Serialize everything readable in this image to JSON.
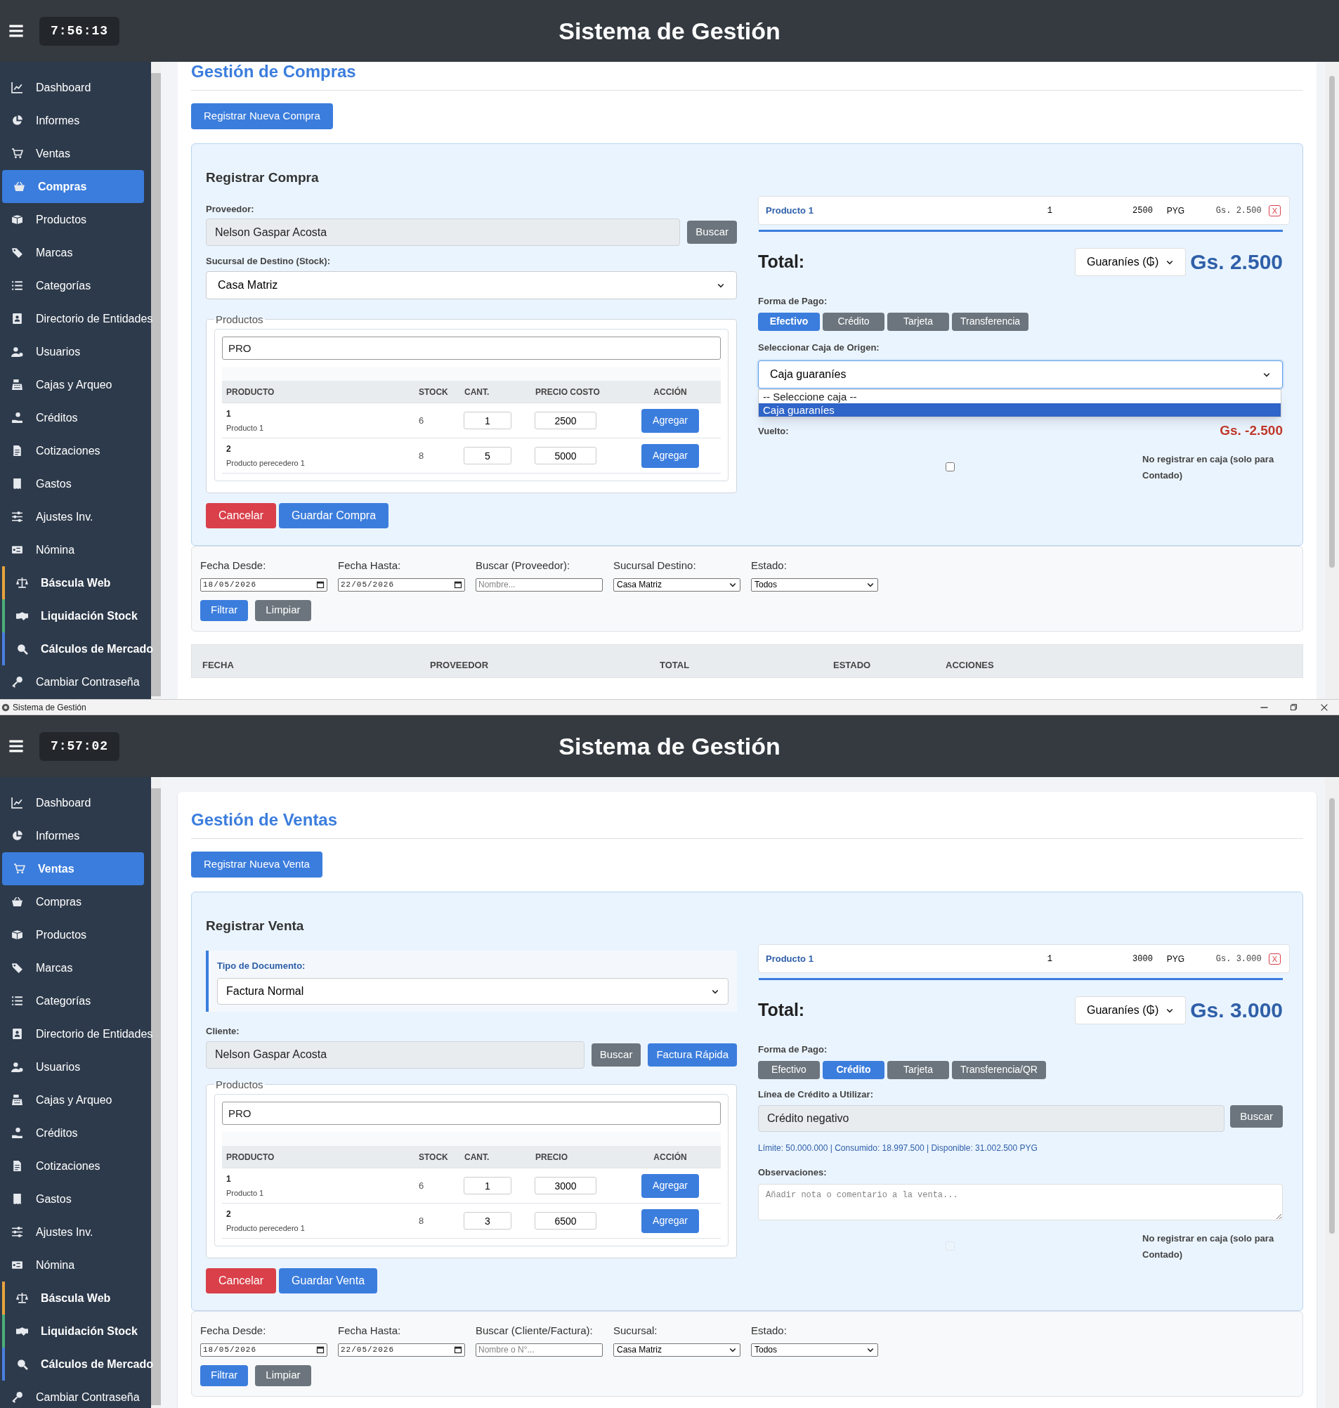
{
  "screens": [
    {
      "header": {
        "clock": "7:56:13",
        "title": "Sistema de Gestión"
      },
      "sidebar": [
        {
          "label": "Dashboard",
          "selected": false
        },
        {
          "label": "Informes",
          "selected": false
        },
        {
          "label": "Ventas",
          "selected": false
        },
        {
          "label": "Compras",
          "selected": true
        },
        {
          "label": "Productos",
          "selected": false
        },
        {
          "label": "Marcas",
          "selected": false
        },
        {
          "label": "Categorías",
          "selected": false
        },
        {
          "label": "Directorio de Entidades",
          "selected": false
        },
        {
          "label": "Usuarios",
          "selected": false
        },
        {
          "label": "Cajas y Arqueo",
          "selected": false
        },
        {
          "label": "Créditos",
          "selected": false
        },
        {
          "label": "Cotizaciones",
          "selected": false
        },
        {
          "label": "Gastos",
          "selected": false
        },
        {
          "label": "Ajustes Inv.",
          "selected": false
        },
        {
          "label": "Nómina",
          "selected": false
        },
        {
          "label": "Báscula Web",
          "selected": false,
          "color": "#e8a33d"
        },
        {
          "label": "Liquidación Stock",
          "selected": false,
          "color": "#4caf7a"
        },
        {
          "label": "Cálculos de Mercado",
          "selected": false,
          "color": "#4a7fe0"
        },
        {
          "label": "Cambiar Contraseña",
          "selected": false
        }
      ],
      "page_title": "Gestión de Compras",
      "new_button": "Registrar Nueva Compra",
      "form": {
        "title": "Registrar Compra",
        "fields": [
          {
            "kind": "lookup",
            "label": "Proveedor:",
            "value": "Nelson Gaspar Acosta",
            "buttons": [
              {
                "label": "Buscar",
                "kind": "secondary"
              }
            ]
          },
          {
            "kind": "select",
            "label": "Sucursal de Destino (Stock):",
            "value": "Casa Matriz"
          }
        ],
        "products": {
          "legend": "Productos",
          "search": "PRO",
          "columns": [
            "PRODUCTO",
            "STOCK",
            "CANT.",
            "PRECIO COSTO",
            "ACCIÓN"
          ],
          "rows": [
            {
              "code": "1",
              "name": "Producto 1",
              "stock": "6",
              "qty": "1",
              "price": "2500",
              "action": "Agregar"
            },
            {
              "code": "2",
              "name": "Producto perecedero 1",
              "stock": "8",
              "qty": "5",
              "price": "5000",
              "action": "Agregar"
            }
          ]
        },
        "buttons": [
          {
            "label": "Cancelar",
            "kind": "danger"
          },
          {
            "label": "Guardar Compra",
            "kind": "primary"
          }
        ]
      },
      "cart": {
        "items": [
          {
            "name": "Producto 1",
            "qty": "1",
            "price": "2500",
            "currency": "PYG",
            "subtotal": "Gs. 2.500",
            "remove": "X"
          }
        ],
        "total_label": "Total:",
        "currency_select": "Guaraníes (₲)",
        "total": "Gs. 2.500",
        "payment_label": "Forma de Pago:",
        "payment_methods": [
          {
            "label": "Efectivo",
            "selected": true
          },
          {
            "label": "Crédito",
            "selected": false
          },
          {
            "label": "Tarjeta",
            "selected": false
          },
          {
            "label": "Transferencia",
            "selected": false
          }
        ],
        "sections": [
          {
            "kind": "select",
            "label": "Seleccionar Caja de Origen:",
            "value": "Caja guaraníes",
            "expanded": true,
            "options": [
              {
                "label": "-- Seleccione caja --",
                "selected": false
              },
              {
                "label": "Caja guaraníes",
                "selected": true
              }
            ]
          },
          {
            "kind": "change",
            "label": "Vuelto:",
            "value": "Gs. -2.500"
          }
        ],
        "no_register": {
          "checked": false,
          "disabled": false,
          "label": "No registrar en caja (solo para Contado)"
        }
      },
      "filters": {
        "fields": [
          {
            "kind": "date",
            "label": "Fecha Desde:",
            "value": "18/05/2026"
          },
          {
            "kind": "date",
            "label": "Fecha Hasta:",
            "value": "22/05/2026"
          },
          {
            "kind": "text",
            "label": "Buscar (Proveedor):",
            "placeholder": "Nombre..."
          },
          {
            "kind": "select",
            "label": "Sucursal Destino:",
            "value": "Casa Matriz"
          },
          {
            "kind": "select",
            "label": "Estado:",
            "value": "Todos"
          }
        ],
        "buttons": [
          {
            "label": "Filtrar",
            "kind": "primary"
          },
          {
            "label": "Limpiar",
            "kind": "secondary"
          }
        ]
      },
      "table": {
        "columns": [
          "FECHA",
          "PROVEEDOR",
          "TOTAL",
          "ESTADO",
          "ACCIONES"
        ]
      }
    },
    {
      "header": {
        "clock": "7:57:02",
        "title": "Sistema de Gestión"
      },
      "sidebar": [
        {
          "label": "Dashboard",
          "selected": false
        },
        {
          "label": "Informes",
          "selected": false
        },
        {
          "label": "Ventas",
          "selected": true
        },
        {
          "label": "Compras",
          "selected": false
        },
        {
          "label": "Productos",
          "selected": false
        },
        {
          "label": "Marcas",
          "selected": false
        },
        {
          "label": "Categorías",
          "selected": false
        },
        {
          "label": "Directorio de Entidades",
          "selected": false
        },
        {
          "label": "Usuarios",
          "selected": false
        },
        {
          "label": "Cajas y Arqueo",
          "selected": false
        },
        {
          "label": "Créditos",
          "selected": false
        },
        {
          "label": "Cotizaciones",
          "selected": false
        },
        {
          "label": "Gastos",
          "selected": false
        },
        {
          "label": "Ajustes Inv.",
          "selected": false
        },
        {
          "label": "Nómina",
          "selected": false
        },
        {
          "label": "Báscula Web",
          "selected": false,
          "color": "#e8a33d"
        },
        {
          "label": "Liquidación Stock",
          "selected": false,
          "color": "#4caf7a"
        },
        {
          "label": "Cálculos de Mercado",
          "selected": false,
          "color": "#4a7fe0"
        },
        {
          "label": "Cambiar Contraseña",
          "selected": false
        }
      ],
      "page_title": "Gestión de Ventas",
      "new_button": "Registrar Nueva Venta",
      "form": {
        "title": "Registrar Venta",
        "fields": [
          {
            "kind": "doc_select",
            "label": "Tipo de Documento:",
            "value": "Factura Normal"
          },
          {
            "kind": "lookup",
            "label": "Cliente:",
            "value": "Nelson Gaspar Acosta",
            "buttons": [
              {
                "label": "Buscar",
                "kind": "secondary"
              },
              {
                "label": "Factura Rápida",
                "kind": "primary"
              }
            ]
          }
        ],
        "products": {
          "legend": "Productos",
          "search": "PRO",
          "columns": [
            "PRODUCTO",
            "STOCK",
            "CANT.",
            "PRECIO",
            "ACCIÓN"
          ],
          "rows": [
            {
              "code": "1",
              "name": "Producto 1",
              "stock": "6",
              "qty": "1",
              "price": "3000",
              "action": "Agregar"
            },
            {
              "code": "2",
              "name": "Producto perecedero 1",
              "stock": "8",
              "qty": "3",
              "price": "6500",
              "action": "Agregar"
            }
          ]
        },
        "buttons": [
          {
            "label": "Cancelar",
            "kind": "danger"
          },
          {
            "label": "Guardar Venta",
            "kind": "primary"
          }
        ]
      },
      "cart": {
        "items": [
          {
            "name": "Producto 1",
            "qty": "1",
            "price": "3000",
            "currency": "PYG",
            "subtotal": "Gs. 3.000",
            "remove": "X"
          }
        ],
        "total_label": "Total:",
        "currency_select": "Guaraníes (₲)",
        "total": "Gs. 3.000",
        "payment_label": "Forma de Pago:",
        "payment_methods": [
          {
            "label": "Efectivo",
            "selected": false
          },
          {
            "label": "Crédito",
            "selected": true
          },
          {
            "label": "Tarjeta",
            "selected": false
          },
          {
            "label": "Transferencia/QR",
            "selected": false
          }
        ],
        "sections": [
          {
            "kind": "lookup",
            "label": "Línea de Crédito a Utilizar:",
            "value": "Crédito negativo",
            "buttons": [
              {
                "label": "Buscar",
                "kind": "secondary"
              }
            ]
          },
          {
            "kind": "note",
            "text": "Límite: 50.000.000 | Consumido: 18.997.500 | Disponible: 31.002.500 PYG"
          },
          {
            "kind": "textarea",
            "label": "Observaciones:",
            "placeholder": "Añadir nota o comentario a la venta..."
          }
        ],
        "no_register": {
          "checked": false,
          "disabled": true,
          "label": "No registrar en caja (solo para Contado)"
        }
      },
      "filters": {
        "fields": [
          {
            "kind": "date",
            "label": "Fecha Desde:",
            "value": "18/05/2026"
          },
          {
            "kind": "date",
            "label": "Fecha Hasta:",
            "value": "22/05/2026"
          },
          {
            "kind": "text",
            "label": "Buscar (Cliente/Factura):",
            "placeholder": "Nombre o N°..."
          },
          {
            "kind": "select",
            "label": "Sucursal:",
            "value": "Casa Matriz"
          },
          {
            "kind": "select",
            "label": "Estado:",
            "value": "Todos"
          }
        ],
        "buttons": [
          {
            "label": "Filtrar",
            "kind": "primary"
          },
          {
            "label": "Limpiar",
            "kind": "secondary"
          }
        ]
      }
    }
  ],
  "window_bar": {
    "title": "Sistema de Gestión"
  }
}
